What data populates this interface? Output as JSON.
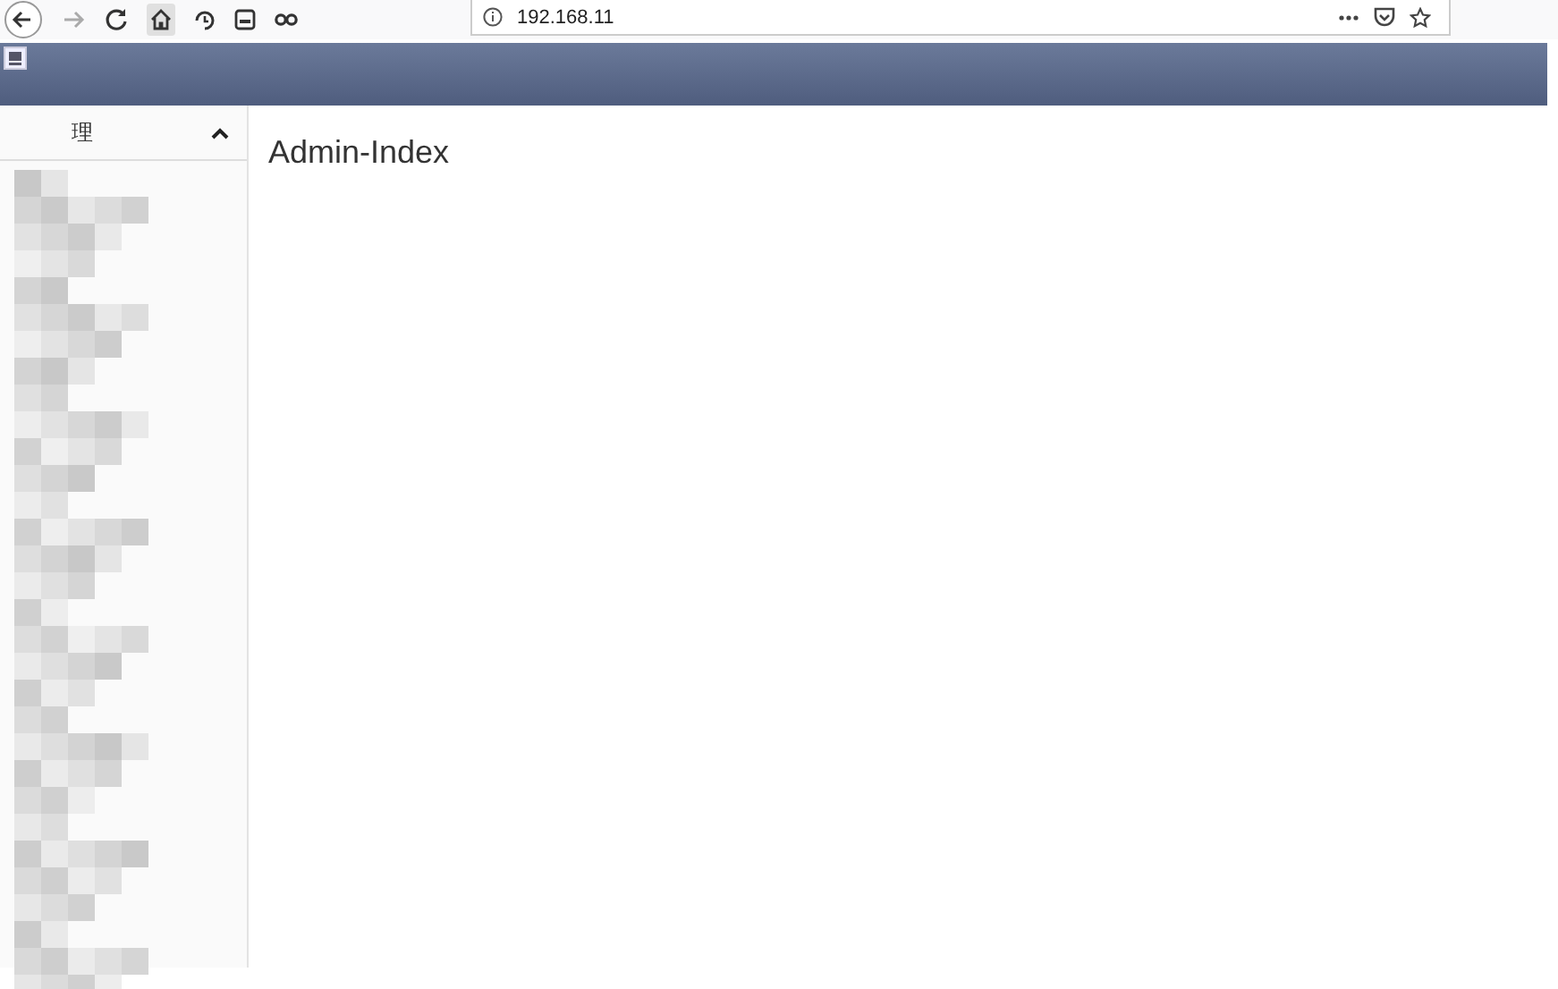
{
  "browser": {
    "address": "192.168.11"
  },
  "sidebar": {
    "section": {
      "label": "理",
      "expanded": true
    }
  },
  "main": {
    "title": "Admin-Index"
  }
}
